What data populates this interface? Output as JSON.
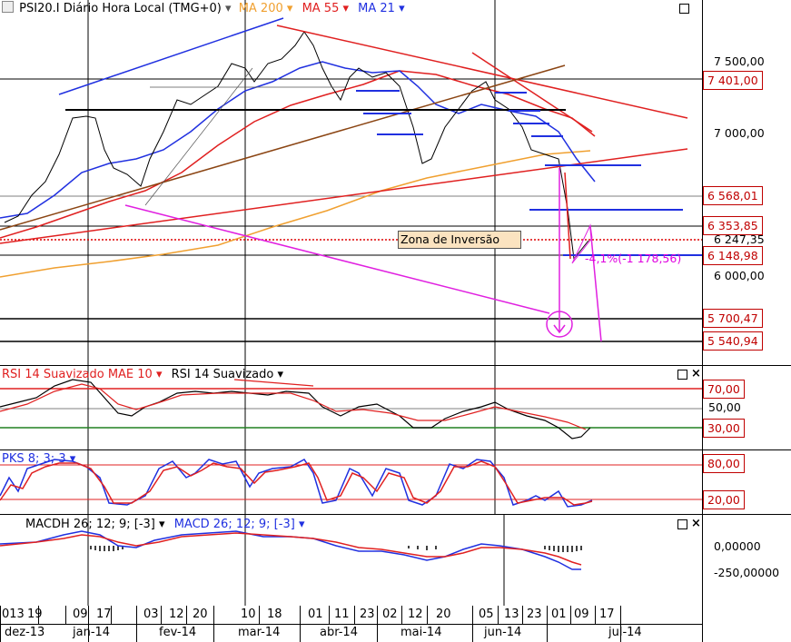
{
  "header": {
    "symbol": "PSI20.I Diário Hora Local (TMG+0)",
    "ma200": "MA 200",
    "ma55": "MA 55",
    "ma21": "MA 21"
  },
  "price_labels": {
    "p7500": "7 500,00",
    "p7401": "7 401,00",
    "p7000": "7 000,00",
    "p6568": "6 568,01",
    "p6353": "6 353,85",
    "p6247": "6 247,35",
    "p6148": "6 148,98",
    "p6000": "6 000,00",
    "p5700": "5 700,47",
    "p5540": "5 540,94"
  },
  "annotations": {
    "zona": "Zona de  Inversão",
    "pct": "-4,1%(-1 178,56)"
  },
  "rsi": {
    "title1": "RSI 14 Suavizado MAE 10",
    "title2": "RSI 14 Suavizado",
    "l70": "70,00",
    "l50": "50,00",
    "l30": "30,00"
  },
  "pks": {
    "title": "PKS 8; 3; 3",
    "l80": "80,00",
    "l20": "20,00"
  },
  "macd": {
    "title1": "MACDH 26; 12; 9; [-3]",
    "title2": "MACD 26; 12; 9; [-3]",
    "l0": "0,00000",
    "lneg": "-250,00000"
  },
  "dates": {
    "days": [
      "013",
      "19",
      "09",
      "17",
      "03",
      "12",
      "20",
      "10",
      "18",
      "01",
      "11",
      "23",
      "02",
      "12",
      "20",
      "05",
      "13",
      "23",
      "01",
      "09",
      "17"
    ],
    "months": [
      "dez-13",
      "jan-14",
      "fev-14",
      "mar-14",
      "abr-14",
      "mai-14",
      "jun-14",
      "jul-14"
    ]
  },
  "colors": {
    "ma200": "#f0a030",
    "ma55": "#e02020",
    "ma21": "#2030e0",
    "magenta": "#e020e0",
    "label": "#c00000"
  }
}
